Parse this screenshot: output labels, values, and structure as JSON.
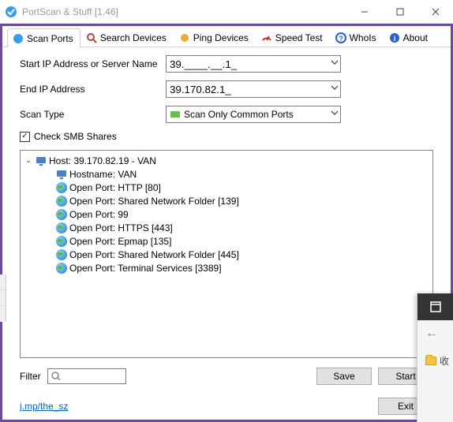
{
  "window": {
    "title": "PortScan & Stuff [1.46]"
  },
  "tabs": [
    {
      "label": "Scan Ports",
      "icon": "scan-ports",
      "active": true
    },
    {
      "label": "Search Devices",
      "icon": "search-devices"
    },
    {
      "label": "Ping Devices",
      "icon": "ping-devices"
    },
    {
      "label": "Speed Test",
      "icon": "speed-test"
    },
    {
      "label": "WhoIs",
      "icon": "whois"
    },
    {
      "label": "About",
      "icon": "about"
    }
  ],
  "form": {
    "start_label": "Start IP Address or Server Name",
    "start_value": "39.____.__.1_",
    "end_label": "End IP Address",
    "end_value": "39.170.82.1_",
    "scantype_label": "Scan Type",
    "scantype_value": "Scan Only Common Ports",
    "smb_label": "Check SMB Shares",
    "smb_checked": true
  },
  "tree": {
    "host_line": "Host: 39.170.82.19 - VAN",
    "children": [
      "Hostname: VAN",
      "Open Port: HTTP [80]",
      "Open Port: Shared Network Folder [139]",
      "Open Port: 99",
      "Open Port: HTTPS [443]",
      "Open Port: Epmap [135]",
      "Open Port: Shared Network Folder [445]",
      "Open Port: Terminal Services [3389]"
    ]
  },
  "bottom": {
    "filter_label": "Filter",
    "save_label": "Save",
    "start_label": "Start",
    "exit_label": "Exit"
  },
  "footer": {
    "link_text": "j.mp/the_sz"
  },
  "side": {
    "back": "←",
    "fav": "收"
  }
}
